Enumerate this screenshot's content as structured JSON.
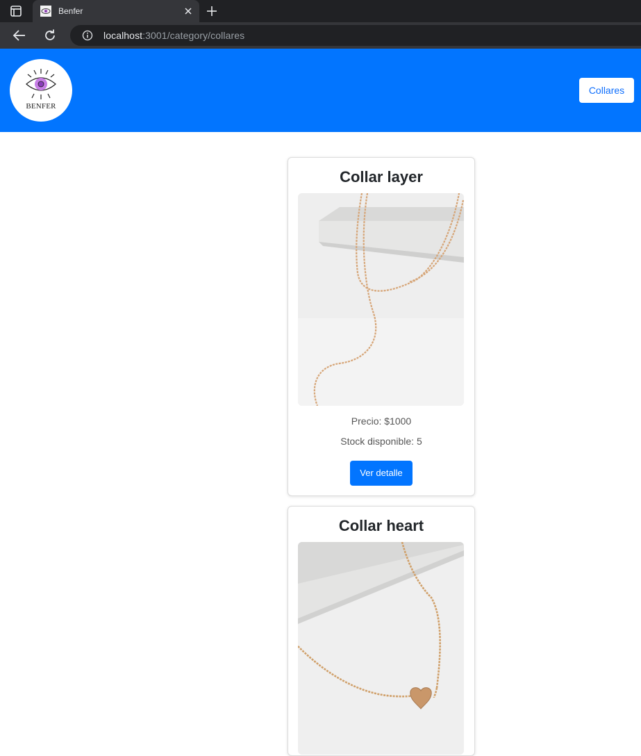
{
  "browser": {
    "tab_title": "Benfer",
    "url_host": "localhost",
    "url_path": ":3001/category/collares"
  },
  "header": {
    "logo_text": "BENFER",
    "nav_button": "Collares",
    "brand_color": "#0275ff"
  },
  "products": [
    {
      "title": "Collar layer",
      "price": "Precio: $1000",
      "stock": "Stock disponible: 5",
      "button": "Ver detalle"
    },
    {
      "title": "Collar heart"
    }
  ]
}
